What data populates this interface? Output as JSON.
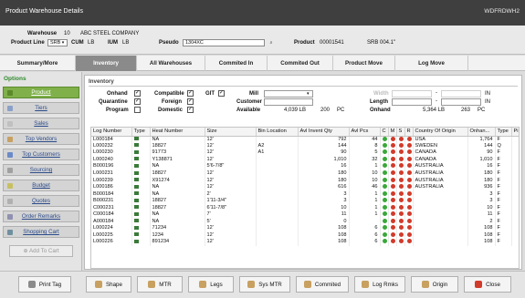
{
  "window": {
    "title": "Product Warehouse Details",
    "code": "WDFRDWH2"
  },
  "header": {
    "warehouse_label": "Warehouse",
    "warehouse_num": "10",
    "warehouse_name": "ABC STEEL COMPANY",
    "product_line_label": "Product Line",
    "product_line_value": "SRB",
    "cum_label": "CUM",
    "cum_value": "LB",
    "ium_label": "IUM",
    "ium_value": "LB",
    "pseudo_label": "Pseudo",
    "pseudo_value": "1304XC",
    "product_label": "Product",
    "product_value": "00001541",
    "product_desc": "SRB 004.1\""
  },
  "tabs": [
    "Summary/More",
    "Inventory",
    "All Warehouses",
    "Commited In",
    "Commited Out",
    "Product Move",
    "Log Move"
  ],
  "sidebar": {
    "title": "Options",
    "items": [
      "Product",
      "Tiers",
      "Sales",
      "Top Vendors",
      "Top Customers",
      "Sourcing",
      "Budget",
      "Quotes",
      "Order Remarks",
      "Shopping Cart"
    ],
    "add_to_cart": "Add To Cart"
  },
  "inventory": {
    "section_title": "Inventory",
    "flags": {
      "onhand": "Onhand",
      "quarantine": "Quarantine",
      "program": "Program",
      "compatible": "Compatible",
      "foreign": "Foreign",
      "domestic": "Domestic",
      "git": "GIT",
      "mill": "Mill",
      "customer": "Customer",
      "available": "Available",
      "width": "Width",
      "length": "Length",
      "onhand2": "Onhand"
    },
    "available_value": "4,039 LB",
    "available_pcs": "200",
    "pcs_label": "PC",
    "onhand_value": "5,364 LB",
    "onhand_pcs": "263",
    "in_label": "IN",
    "columns": [
      "Log Number",
      "Type",
      "Heat Number",
      "Size",
      "Bin Location",
      "Avl Invent Qty",
      "Avl Pcs",
      "C",
      "M",
      "S",
      "R",
      "Country Of Origin",
      "Onhan...",
      "Type",
      "Pi"
    ],
    "rows": [
      {
        "log": "L000184",
        "heat": "NA",
        "size": "12'",
        "bin": "",
        "qty": "792",
        "pcs": "44",
        "c": "g",
        "m": "rd",
        "s": "rd",
        "r": "rd",
        "country": "USA",
        "onh": "1,764",
        "t": "F"
      },
      {
        "log": "L000232",
        "heat": "18827",
        "size": "12'",
        "bin": "A2",
        "qty": "144",
        "pcs": "8",
        "c": "g",
        "m": "rd",
        "s": "rd",
        "r": "rd",
        "country": "SWEDEN",
        "onh": "144",
        "t": "Q"
      },
      {
        "log": "L000230",
        "heat": "91773",
        "size": "12'",
        "bin": "A1",
        "qty": "90",
        "pcs": "5",
        "c": "g",
        "m": "rd",
        "s": "rd",
        "r": "rd",
        "country": "CANADA",
        "onh": "90",
        "t": "F"
      },
      {
        "log": "L000240",
        "heat": "Y138871",
        "size": "12'",
        "bin": "",
        "qty": "1,010",
        "pcs": "32",
        "c": "g",
        "m": "rd",
        "s": "rd",
        "r": "rd",
        "country": "CANADA",
        "onh": "1,010",
        "t": "F"
      },
      {
        "log": "B000196",
        "heat": "NA",
        "size": "5'6-7/8\"",
        "bin": "",
        "qty": "16",
        "pcs": "1",
        "c": "g",
        "m": "rd",
        "s": "rd",
        "r": "rd",
        "country": "AUSTRALIA",
        "onh": "16",
        "t": "F"
      },
      {
        "log": "L000231",
        "heat": "18827",
        "size": "12'",
        "bin": "",
        "qty": "180",
        "pcs": "10",
        "c": "g",
        "m": "rd",
        "s": "rd",
        "r": "rd",
        "country": "AUSTRALIA",
        "onh": "180",
        "t": "F"
      },
      {
        "log": "L000239",
        "heat": "X91274",
        "size": "12'",
        "bin": "",
        "qty": "180",
        "pcs": "10",
        "c": "g",
        "m": "rd",
        "s": "rd",
        "r": "rd",
        "country": "AUSTRALIA",
        "onh": "180",
        "t": "F"
      },
      {
        "log": "L000186",
        "heat": "NA",
        "size": "12'",
        "bin": "",
        "qty": "616",
        "pcs": "46",
        "c": "g",
        "m": "rd",
        "s": "rd",
        "r": "rd",
        "country": "AUSTRALIA",
        "onh": "936",
        "t": "F"
      },
      {
        "log": "B000184",
        "heat": "NA",
        "size": "2'",
        "bin": "",
        "qty": "3",
        "pcs": "1",
        "c": "g",
        "m": "rd",
        "s": "rd",
        "r": "rd",
        "country": "",
        "onh": "3",
        "t": "F"
      },
      {
        "log": "B000231",
        "heat": "18827",
        "size": "1'11-3/4\"",
        "bin": "",
        "qty": "3",
        "pcs": "1",
        "c": "g",
        "m": "rd",
        "s": "rd",
        "r": "rd",
        "country": "",
        "onh": "3",
        "t": "F"
      },
      {
        "log": "C000231",
        "heat": "18827",
        "size": "6'11-7/8\"",
        "bin": "",
        "qty": "10",
        "pcs": "1",
        "c": "g",
        "m": "rd",
        "s": "rd",
        "r": "rd",
        "country": "",
        "onh": "10",
        "t": "F"
      },
      {
        "log": "C000184",
        "heat": "NA",
        "size": "7'",
        "bin": "",
        "qty": "11",
        "pcs": "1",
        "c": "g",
        "m": "rd",
        "s": "rd",
        "r": "rd",
        "country": "",
        "onh": "11",
        "t": "F"
      },
      {
        "log": "A000184",
        "heat": "NA",
        "size": "5'",
        "bin": "",
        "qty": "0",
        "pcs": "",
        "c": "g",
        "m": "rd",
        "s": "rd",
        "r": "rd",
        "country": "",
        "onh": "2",
        "t": "F"
      },
      {
        "log": "L000224",
        "heat": "71234",
        "size": "12'",
        "bin": "",
        "qty": "108",
        "pcs": "6",
        "c": "g",
        "m": "rd",
        "s": "rd",
        "r": "rd",
        "country": "",
        "onh": "108",
        "t": "F"
      },
      {
        "log": "L000225",
        "heat": "1234",
        "size": "12'",
        "bin": "",
        "qty": "108",
        "pcs": "6",
        "c": "g",
        "m": "rd",
        "s": "rd",
        "r": "rd",
        "country": "",
        "onh": "108",
        "t": "F"
      },
      {
        "log": "L000226",
        "heat": "891234",
        "size": "12'",
        "bin": "",
        "qty": "108",
        "pcs": "6",
        "c": "g",
        "m": "rd",
        "s": "rd",
        "r": "rd",
        "country": "",
        "onh": "108",
        "t": "F"
      }
    ]
  },
  "footer_buttons": [
    "Print Tag",
    "Shape",
    "MTR",
    "Legs",
    "Sys MTR",
    "Commited",
    "Log Rmks",
    "Origin",
    "Close"
  ],
  "colors": {
    "accent_green": "#7fb04a",
    "titlebar": "#3f3f3f",
    "active_tab": "#8a8a8a"
  }
}
